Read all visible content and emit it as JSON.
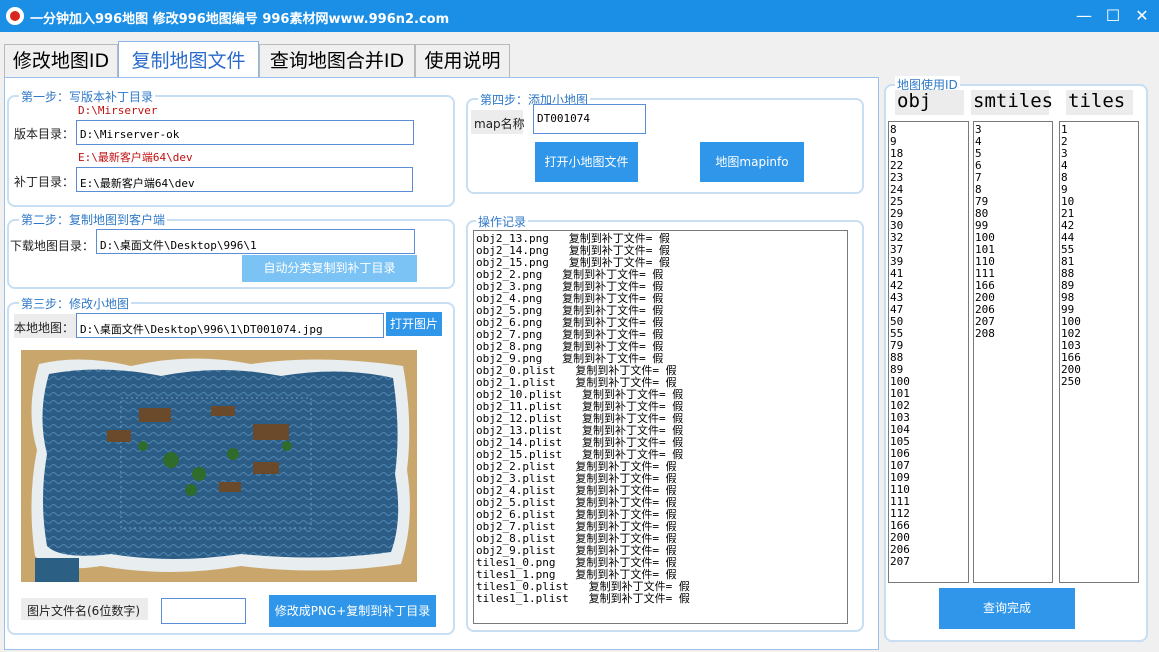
{
  "window": {
    "title": "一分钟加入996地图   修改996地图编号   996素材网www.996n2.com",
    "min": "—",
    "max": "☐",
    "close": "✕"
  },
  "tabs": [
    "修改地图ID",
    "复制地图文件",
    "查询地图合并ID",
    "使用说明"
  ],
  "step1": {
    "title": "第一步：写版本补丁目录",
    "hint_version": "D:\\Mirserver",
    "version_label": "版本目录：",
    "version_value": "D:\\Mirserver-ok",
    "hint_patch": "E:\\最新客户端64\\dev",
    "patch_label": "补丁目录：",
    "patch_value": "E:\\最新客户端64\\dev"
  },
  "step2": {
    "title": "第二步：复制地图到客户端",
    "download_label": "下载地图目录：",
    "download_value": "D:\\桌面文件\\Desktop\\996\\1",
    "auto_copy_button": "自动分类复制到补丁目录"
  },
  "step3": {
    "title": "第三步：修改小地图",
    "local_label": "本地地图：",
    "local_value": "D:\\桌面文件\\Desktop\\996\\1\\DT001074.jpg",
    "open_image_button": "打开图片",
    "filename_label": "图片文件名(6位数字)",
    "filename_value": "",
    "convert_button": "修改成PNG+复制到补丁目录"
  },
  "step4": {
    "title": "第四步：添加小地图",
    "map_name_label": "map名称",
    "map_name_value": "DT001074",
    "open_minimap_button": "打开小地图文件",
    "mapinfo_button": "地图mapinfo"
  },
  "log": {
    "title": "操作记录",
    "lines": [
      "obj2_13.png   复制到补丁文件= 假",
      "obj2_14.png   复制到补丁文件= 假",
      "obj2_15.png   复制到补丁文件= 假",
      "obj2_2.png   复制到补丁文件= 假",
      "obj2_3.png   复制到补丁文件= 假",
      "obj2_4.png   复制到补丁文件= 假",
      "obj2_5.png   复制到补丁文件= 假",
      "obj2_6.png   复制到补丁文件= 假",
      "obj2_7.png   复制到补丁文件= 假",
      "obj2_8.png   复制到补丁文件= 假",
      "obj2_9.png   复制到补丁文件= 假",
      "obj2_0.plist   复制到补丁文件= 假",
      "obj2_1.plist   复制到补丁文件= 假",
      "obj2_10.plist   复制到补丁文件= 假",
      "obj2_11.plist   复制到补丁文件= 假",
      "obj2_12.plist   复制到补丁文件= 假",
      "obj2_13.plist   复制到补丁文件= 假",
      "obj2_14.plist   复制到补丁文件= 假",
      "obj2_15.plist   复制到补丁文件= 假",
      "obj2_2.plist   复制到补丁文件= 假",
      "obj2_3.plist   复制到补丁文件= 假",
      "obj2_4.plist   复制到补丁文件= 假",
      "obj2_5.plist   复制到补丁文件= 假",
      "obj2_6.plist   复制到补丁文件= 假",
      "obj2_7.plist   复制到补丁文件= 假",
      "obj2_8.plist   复制到补丁文件= 假",
      "obj2_9.plist   复制到补丁文件= 假",
      "tiles1_0.png   复制到补丁文件= 假",
      "tiles1_1.png   复制到补丁文件= 假",
      "tiles1_0.plist   复制到补丁文件= 假",
      "tiles1_1.plist   复制到补丁文件= 假"
    ]
  },
  "ids": {
    "title": "地图使用ID",
    "obj_header": "obj",
    "smtiles_header": "smtiles",
    "tiles_header": "tiles",
    "obj": [
      "8",
      "9",
      "18",
      "22",
      "23",
      "24",
      "25",
      "29",
      "30",
      "32",
      "37",
      "39",
      "41",
      "42",
      "43",
      "47",
      "50",
      "55",
      "79",
      "88",
      "89",
      "100",
      "101",
      "102",
      "103",
      "104",
      "105",
      "106",
      "107",
      "109",
      "110",
      "111",
      "112",
      "166",
      "200",
      "206",
      "207"
    ],
    "smtiles": [
      "3",
      "4",
      "5",
      "6",
      "7",
      "8",
      "79",
      "80",
      "99",
      "100",
      "101",
      "110",
      "111",
      "166",
      "200",
      "206",
      "207",
      "208"
    ],
    "tiles": [
      "1",
      "2",
      "3",
      "4",
      "8",
      "9",
      "10",
      "21",
      "42",
      "44",
      "55",
      "81",
      "88",
      "89",
      "98",
      "99",
      "100",
      "102",
      "103",
      "166",
      "200",
      "250"
    ],
    "query_done_button": "查询完成"
  }
}
